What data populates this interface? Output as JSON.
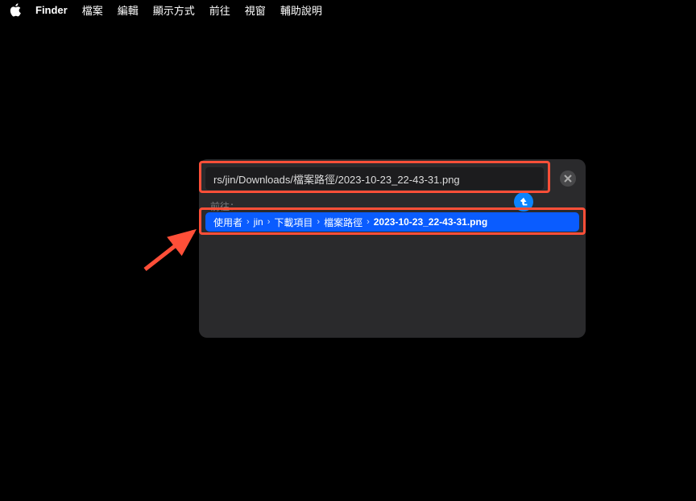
{
  "menubar": {
    "app_name": "Finder",
    "items": [
      "檔案",
      "編輯",
      "顯示方式",
      "前往",
      "視窗",
      "輔助說明"
    ]
  },
  "dialog": {
    "input_value": "rs/jin/Downloads/檔案路徑/2023-10-23_22-43-31.png",
    "goto_label": "前往：",
    "breadcrumb": [
      "使用者",
      "jin",
      "下載項目",
      "檔案路徑",
      "2023-10-23_22-43-31.png"
    ]
  },
  "annotation": {
    "box_color": "#ff4f38",
    "arrow_color": "#ff4f38"
  }
}
